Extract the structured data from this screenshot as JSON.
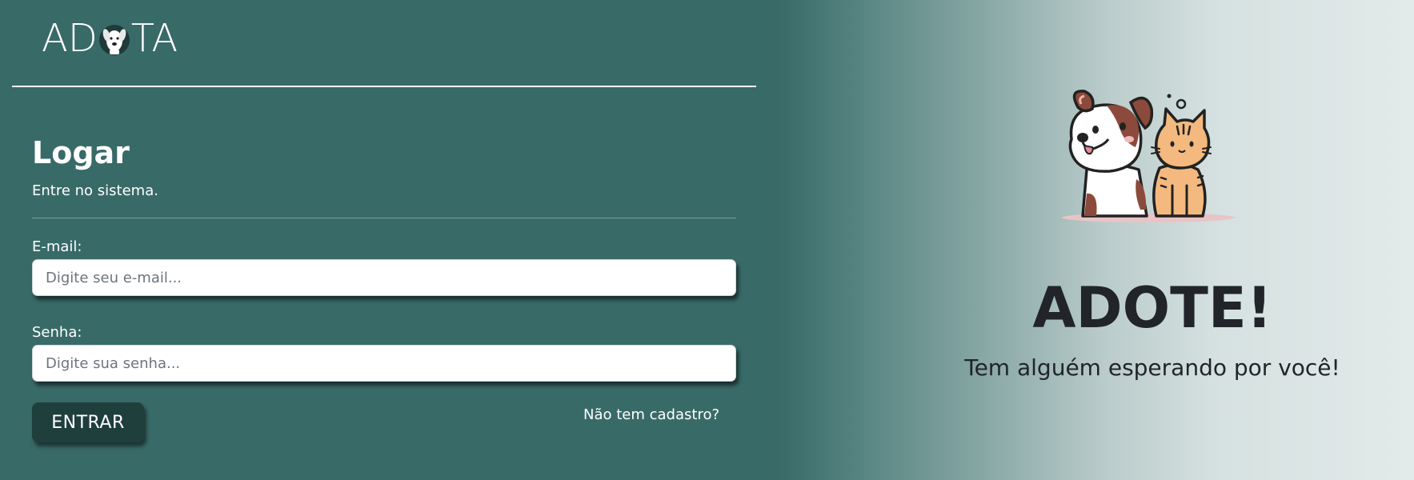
{
  "brand": {
    "logo_left": "AD",
    "logo_right": "TA",
    "logo_icon": "dog-face-icon"
  },
  "login": {
    "title": "Logar",
    "subtitle": "Entre no sistema.",
    "email_label": "E-mail:",
    "email_placeholder": "Digite seu e-mail...",
    "email_value": "",
    "password_label": "Senha:",
    "password_placeholder": "Digite sua senha...",
    "password_value": "",
    "submit_label": "ENTRAR",
    "register_link": "Não tem cadastro?"
  },
  "hero": {
    "illustration": "dog-and-cat-icon",
    "title": "ADOTE!",
    "subtitle": "Tem alguém esperando por você!"
  },
  "colors": {
    "panel_teal": "#386a68",
    "button_dark": "#1f3f3d",
    "text_dark": "#212529",
    "light_end": "#e3eaea"
  }
}
